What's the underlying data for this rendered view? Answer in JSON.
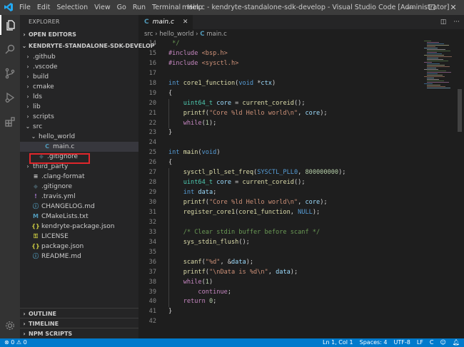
{
  "window": {
    "title": "main.c - kendryte-standalone-sdk-develop - Visual Studio Code [Administrator]",
    "menu": [
      "File",
      "Edit",
      "Selection",
      "View",
      "Go",
      "Run",
      "Terminal",
      "Help"
    ],
    "controls": [
      "—",
      "☐",
      "✕"
    ]
  },
  "activity_icons": [
    "files-icon",
    "search-icon",
    "source-control-icon",
    "run-debug-icon",
    "extensions-icon",
    "gear-icon"
  ],
  "explorer": {
    "header": "EXPLORER",
    "open_editors": "OPEN EDITORS",
    "project": "KENDRYTE-STANDALONE-SDK-DEVELOP",
    "items": [
      {
        "label": ".github",
        "type": "folder",
        "depth": 0,
        "expanded": false
      },
      {
        "label": ".vscode",
        "type": "folder",
        "depth": 0,
        "expanded": false
      },
      {
        "label": "build",
        "type": "folder",
        "depth": 0,
        "expanded": false
      },
      {
        "label": "cmake",
        "type": "folder",
        "depth": 0,
        "expanded": false
      },
      {
        "label": "lds",
        "type": "folder",
        "depth": 0,
        "expanded": false
      },
      {
        "label": "lib",
        "type": "folder",
        "depth": 0,
        "expanded": false
      },
      {
        "label": "scripts",
        "type": "folder",
        "depth": 0,
        "expanded": false
      },
      {
        "label": "src",
        "type": "folder",
        "depth": 0,
        "expanded": true
      },
      {
        "label": "hello_world",
        "type": "folder",
        "depth": 1,
        "expanded": true
      },
      {
        "label": "main.c",
        "type": "c",
        "depth": 2,
        "selected": true
      },
      {
        "label": ".gitignore",
        "type": "git",
        "depth": 1
      },
      {
        "label": "third_party",
        "type": "folder",
        "depth": 0,
        "expanded": false
      },
      {
        "label": ".clang-format",
        "type": "lines",
        "depth": 0
      },
      {
        "label": ".gitignore",
        "type": "git",
        "depth": 0
      },
      {
        "label": ".travis.yml",
        "type": "yml",
        "depth": 0
      },
      {
        "label": "CHANGELOG.md",
        "type": "info",
        "depth": 0
      },
      {
        "label": "CMakeLists.txt",
        "type": "cmake",
        "depth": 0
      },
      {
        "label": "kendryte-package.json",
        "type": "json",
        "depth": 0
      },
      {
        "label": "LICENSE",
        "type": "license",
        "depth": 0
      },
      {
        "label": "package.json",
        "type": "json",
        "depth": 0
      },
      {
        "label": "README.md",
        "type": "info",
        "depth": 0
      }
    ],
    "outline": "OUTLINE",
    "timeline": "TIMELINE",
    "npm_scripts": "NPM SCRIPTS"
  },
  "editor": {
    "tab_label": "main.c",
    "tab_icon": "C",
    "breadcrumb": [
      "src",
      "hello_world",
      "main.c"
    ],
    "lines": [
      {
        "n": "14",
        "code": [
          [
            "cm",
            " */"
          ]
        ]
      },
      {
        "n": "15",
        "code": [
          [
            "pp",
            "#include"
          ],
          [
            "t",
            " "
          ],
          [
            "st",
            "<bsp.h>"
          ]
        ]
      },
      {
        "n": "16",
        "code": [
          [
            "pp",
            "#include"
          ],
          [
            "t",
            " "
          ],
          [
            "st",
            "<sysctl.h>"
          ]
        ]
      },
      {
        "n": "17",
        "code": []
      },
      {
        "n": "18",
        "code": [
          [
            "kw",
            "int"
          ],
          [
            "t",
            " "
          ],
          [
            "fn",
            "core1_function"
          ],
          [
            "t",
            "("
          ],
          [
            "kw",
            "void"
          ],
          [
            "t",
            " *"
          ],
          [
            "pr",
            "ctx"
          ],
          [
            "t",
            ")"
          ]
        ]
      },
      {
        "n": "19",
        "code": [
          [
            "t",
            "{"
          ]
        ]
      },
      {
        "n": "20",
        "code": [
          [
            "t",
            "    "
          ],
          [
            "ty",
            "uint64_t"
          ],
          [
            "t",
            " "
          ],
          [
            "pr",
            "core"
          ],
          [
            "t",
            " = "
          ],
          [
            "fn",
            "current_coreid"
          ],
          [
            "t",
            "();"
          ]
        ]
      },
      {
        "n": "21",
        "code": [
          [
            "t",
            "    "
          ],
          [
            "fn",
            "printf"
          ],
          [
            "t",
            "("
          ],
          [
            "st",
            "\"Core %ld Hello world\\n\""
          ],
          [
            "t",
            ", "
          ],
          [
            "pr",
            "core"
          ],
          [
            "t",
            ");"
          ]
        ]
      },
      {
        "n": "22",
        "code": [
          [
            "t",
            "    "
          ],
          [
            "pp",
            "while"
          ],
          [
            "t",
            "("
          ],
          [
            "nu",
            "1"
          ],
          [
            "t",
            ");"
          ]
        ]
      },
      {
        "n": "23",
        "code": [
          [
            "t",
            "}"
          ]
        ]
      },
      {
        "n": "24",
        "code": []
      },
      {
        "n": "25",
        "code": [
          [
            "kw",
            "int"
          ],
          [
            "t",
            " "
          ],
          [
            "fn",
            "main"
          ],
          [
            "t",
            "("
          ],
          [
            "kw",
            "void"
          ],
          [
            "t",
            ")"
          ]
        ]
      },
      {
        "n": "26",
        "code": [
          [
            "t",
            "{"
          ]
        ]
      },
      {
        "n": "27",
        "code": [
          [
            "t",
            "    "
          ],
          [
            "fn",
            "sysctl_pll_set_freq"
          ],
          [
            "t",
            "("
          ],
          [
            "mc",
            "SYSCTL_PLL0"
          ],
          [
            "t",
            ", "
          ],
          [
            "nu",
            "800000000"
          ],
          [
            "t",
            ");"
          ]
        ]
      },
      {
        "n": "28",
        "code": [
          [
            "t",
            "    "
          ],
          [
            "ty",
            "uint64_t"
          ],
          [
            "t",
            " "
          ],
          [
            "pr",
            "core"
          ],
          [
            "t",
            " = "
          ],
          [
            "fn",
            "current_coreid"
          ],
          [
            "t",
            "();"
          ]
        ]
      },
      {
        "n": "29",
        "code": [
          [
            "t",
            "    "
          ],
          [
            "kw",
            "int"
          ],
          [
            "t",
            " "
          ],
          [
            "pr",
            "data"
          ],
          [
            "t",
            ";"
          ]
        ]
      },
      {
        "n": "30",
        "code": [
          [
            "t",
            "    "
          ],
          [
            "fn",
            "printf"
          ],
          [
            "t",
            "("
          ],
          [
            "st",
            "\"Core %ld Hello world\\n\""
          ],
          [
            "t",
            ", "
          ],
          [
            "pr",
            "core"
          ],
          [
            "t",
            ");"
          ]
        ]
      },
      {
        "n": "31",
        "code": [
          [
            "t",
            "    "
          ],
          [
            "fn",
            "register_core1"
          ],
          [
            "t",
            "("
          ],
          [
            "fn",
            "core1_function"
          ],
          [
            "t",
            ", "
          ],
          [
            "mc",
            "NULL"
          ],
          [
            "t",
            ");"
          ]
        ]
      },
      {
        "n": "32",
        "code": []
      },
      {
        "n": "33",
        "code": [
          [
            "t",
            "    "
          ],
          [
            "cm",
            "/* Clear stdin buffer before scanf */"
          ]
        ]
      },
      {
        "n": "34",
        "code": [
          [
            "t",
            "    "
          ],
          [
            "fn",
            "sys_stdin_flush"
          ],
          [
            "t",
            "();"
          ]
        ]
      },
      {
        "n": "35",
        "code": []
      },
      {
        "n": "36",
        "code": [
          [
            "t",
            "    "
          ],
          [
            "fn",
            "scanf"
          ],
          [
            "t",
            "("
          ],
          [
            "st",
            "\"%d\""
          ],
          [
            "t",
            ", &"
          ],
          [
            "pr",
            "data"
          ],
          [
            "t",
            ");"
          ]
        ]
      },
      {
        "n": "37",
        "code": [
          [
            "t",
            "    "
          ],
          [
            "fn",
            "printf"
          ],
          [
            "t",
            "("
          ],
          [
            "st",
            "\"\\nData is %d\\n\""
          ],
          [
            "t",
            ", "
          ],
          [
            "pr",
            "data"
          ],
          [
            "t",
            ");"
          ]
        ]
      },
      {
        "n": "38",
        "code": [
          [
            "t",
            "    "
          ],
          [
            "pp",
            "while"
          ],
          [
            "t",
            "("
          ],
          [
            "nu",
            "1"
          ],
          [
            "t",
            ")"
          ]
        ]
      },
      {
        "n": "39",
        "code": [
          [
            "t",
            "        "
          ],
          [
            "pp",
            "continue"
          ],
          [
            "t",
            ";"
          ]
        ]
      },
      {
        "n": "40",
        "code": [
          [
            "t",
            "    "
          ],
          [
            "pp",
            "return"
          ],
          [
            "t",
            " "
          ],
          [
            "nu",
            "0"
          ],
          [
            "t",
            ";"
          ]
        ]
      },
      {
        "n": "41",
        "code": [
          [
            "t",
            "}"
          ]
        ]
      },
      {
        "n": "42",
        "code": []
      }
    ]
  },
  "status": {
    "errors": "0",
    "warnings": "0",
    "position": "Ln 1, Col 1",
    "spaces": "Spaces: 4",
    "encoding": "UTF-8",
    "eol": "LF",
    "language": "C"
  },
  "colors": {
    "accent": "#007acc",
    "highlight_box": "#e0262b",
    "c_icon": "#519aba"
  }
}
